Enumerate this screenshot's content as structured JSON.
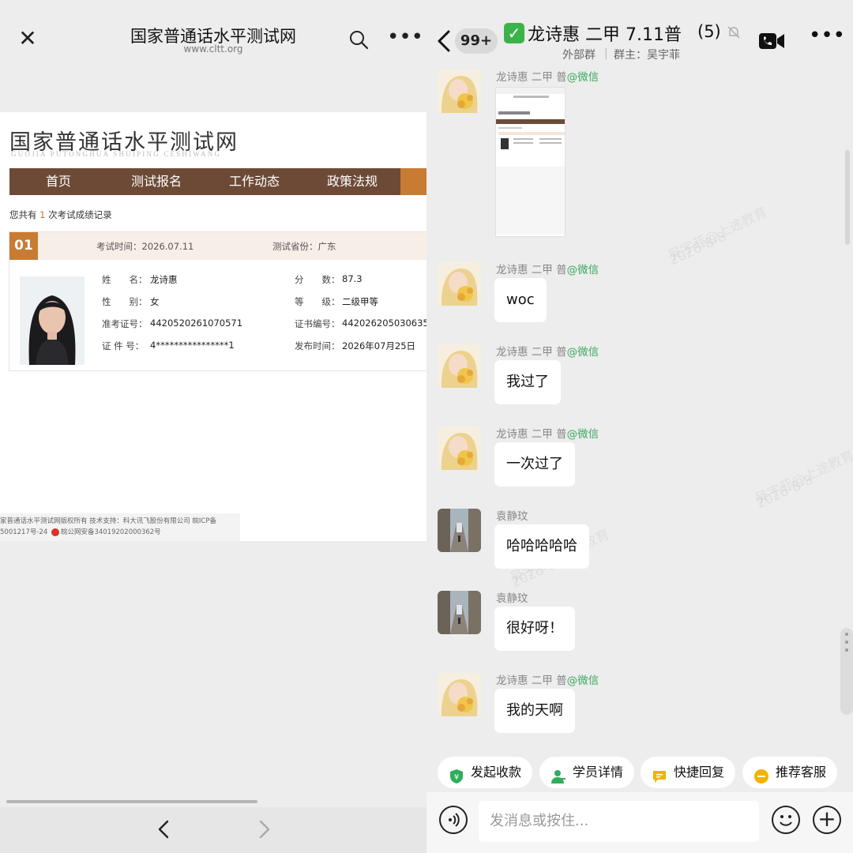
{
  "left": {
    "header": {
      "close_icon": "close-icon",
      "title": "国家普通话水平测试网",
      "url": "www.cltt.org",
      "search_icon": "search-icon",
      "more_icon": "more-icon"
    },
    "site": {
      "logo_cn": "国家普通话水平测试网",
      "logo_pinyin": "GUOJIA PUTONGHUA SHUIPING CESHIWANG",
      "nav": [
        "首页",
        "测试报名",
        "工作动态",
        "政策法规"
      ],
      "record_prefix": "您共有",
      "record_count": "1",
      "record_suffix": "次考试成绩记录",
      "card": {
        "number": "01",
        "exam_time_label": "考试时间：",
        "exam_time": "2026.07.11",
        "province_label": "测试省份：",
        "province": "广东",
        "fields": [
          {
            "label": "姓　　名：",
            "value": "龙诗惠"
          },
          {
            "label": "性　　别：",
            "value": "女"
          },
          {
            "label": "准考证号：",
            "value": "4420520261070571"
          },
          {
            "label": "证 件 号：",
            "value": "4****************1"
          },
          {
            "label": "分　　数：",
            "value": "87.3"
          },
          {
            "label": "等　　级：",
            "value": "二级甲等"
          },
          {
            "label": "证书编号：",
            "value": "442026205030635"
          },
          {
            "label": "发布时间：",
            "value": "2026年07月25日"
          }
        ]
      },
      "footer_line1": "家普通话水平测试网版权所有 技术支持：科大讯飞股份有限公司 皖ICP备",
      "footer_line2_a": "5001217号-24",
      "footer_line2_b": "皖公网安备34019202000362号"
    },
    "bottom_nav": {
      "back_icon": "chevron-left-icon",
      "forward_icon": "chevron-right-icon"
    }
  },
  "right": {
    "header": {
      "unread": "99+",
      "check_icon": "✅",
      "title": "龙诗惠 二甲 7.11普",
      "count": "(5)",
      "subtitle_left": "外部群",
      "subtitle_right": "群主：吴宇菲"
    },
    "watermark_text": "吴宇菲@上途教育",
    "watermark_date": "2026-8-8",
    "messages": [
      {
        "sender": "龙诗惠 二甲 普",
        "via": "@微信",
        "type": "image",
        "text": ""
      },
      {
        "sender": "龙诗惠 二甲 普",
        "via": "@微信",
        "type": "text",
        "text": "woc"
      },
      {
        "sender": "龙诗惠 二甲 普",
        "via": "@微信",
        "type": "text",
        "text": "我过了"
      },
      {
        "sender": "龙诗惠 二甲 普",
        "via": "@微信",
        "type": "text",
        "text": "一次过了"
      },
      {
        "sender": "袁静玟",
        "via": "",
        "type": "text",
        "text": "哈哈哈哈哈"
      },
      {
        "sender": "袁静玟",
        "via": "",
        "type": "text",
        "text": "很好呀！"
      },
      {
        "sender": "龙诗惠 二甲 普",
        "via": "@微信",
        "type": "text",
        "text": "我的天啊"
      }
    ],
    "quick_actions": [
      "发起收款",
      "学员详情",
      "快捷回复",
      "推荐客服"
    ],
    "input_placeholder": "发消息或按住...",
    "colors": {
      "wechat_green": "#3aa860",
      "nav_brown": "#6d4a36",
      "accent_orange": "#c87b33"
    }
  }
}
